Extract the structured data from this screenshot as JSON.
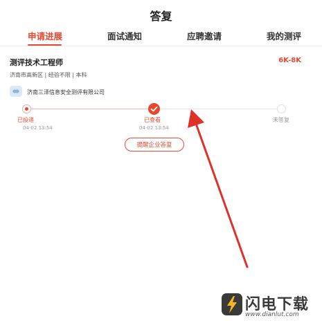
{
  "header": {
    "title": "答复"
  },
  "tabs": [
    {
      "label": "申请进展",
      "active": true
    },
    {
      "label": "面试通知",
      "active": false
    },
    {
      "label": "应聘邀请",
      "active": false
    },
    {
      "label": "我的测评",
      "active": false
    }
  ],
  "job": {
    "title": "测评技术工程师",
    "salary": "6K-8K",
    "meta": "济南市高新区 | 经验不限 | 本科",
    "company": "济南三泽信息安全测评有限公司"
  },
  "progress": {
    "steps": [
      {
        "label": "已投递",
        "time": "04-02 13:54",
        "state": "done"
      },
      {
        "label": "已查看",
        "time": "04-02 13:54",
        "state": "current"
      },
      {
        "label": "未答复",
        "time": "",
        "state": "pending"
      }
    ]
  },
  "actions": {
    "remind_label": "提醒企业答复"
  },
  "watermark": {
    "name": "闪电下载",
    "url": "www.dianlut.com"
  },
  "colors": {
    "accent": "#e8472f",
    "arrow": "#e0302a",
    "watermark_accent": "#f2b822"
  },
  "icons": {
    "company_logo": "company-logo-icon",
    "check": "check-icon",
    "watermark_logo": "lightning-logo-icon"
  }
}
